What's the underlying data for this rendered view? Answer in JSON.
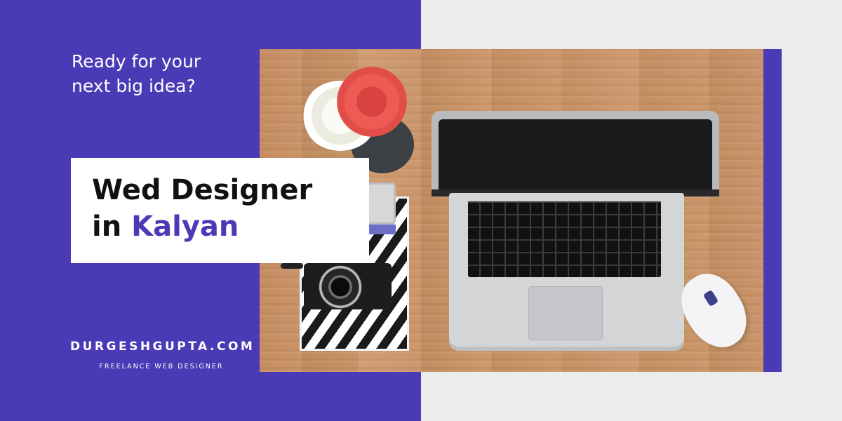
{
  "banner": {
    "tagline": "Ready for your next big idea?",
    "title_line1": "Wed Designer",
    "title_line2_prefix": "in",
    "title_line2_accent": "Kalyan",
    "brand_name": "DURGESHGUPTA.COM",
    "brand_subtitle": "FREELANCE WEB DESIGNER"
  },
  "colors": {
    "primary": "#4b3ab5",
    "background_light": "#ececec",
    "card": "#ffffff",
    "title_text": "#111111"
  },
  "photo": {
    "subject_icons": [
      "laptop-icon",
      "camera-icon",
      "flowers-icon",
      "mouse-icon",
      "notebook-icon"
    ]
  }
}
